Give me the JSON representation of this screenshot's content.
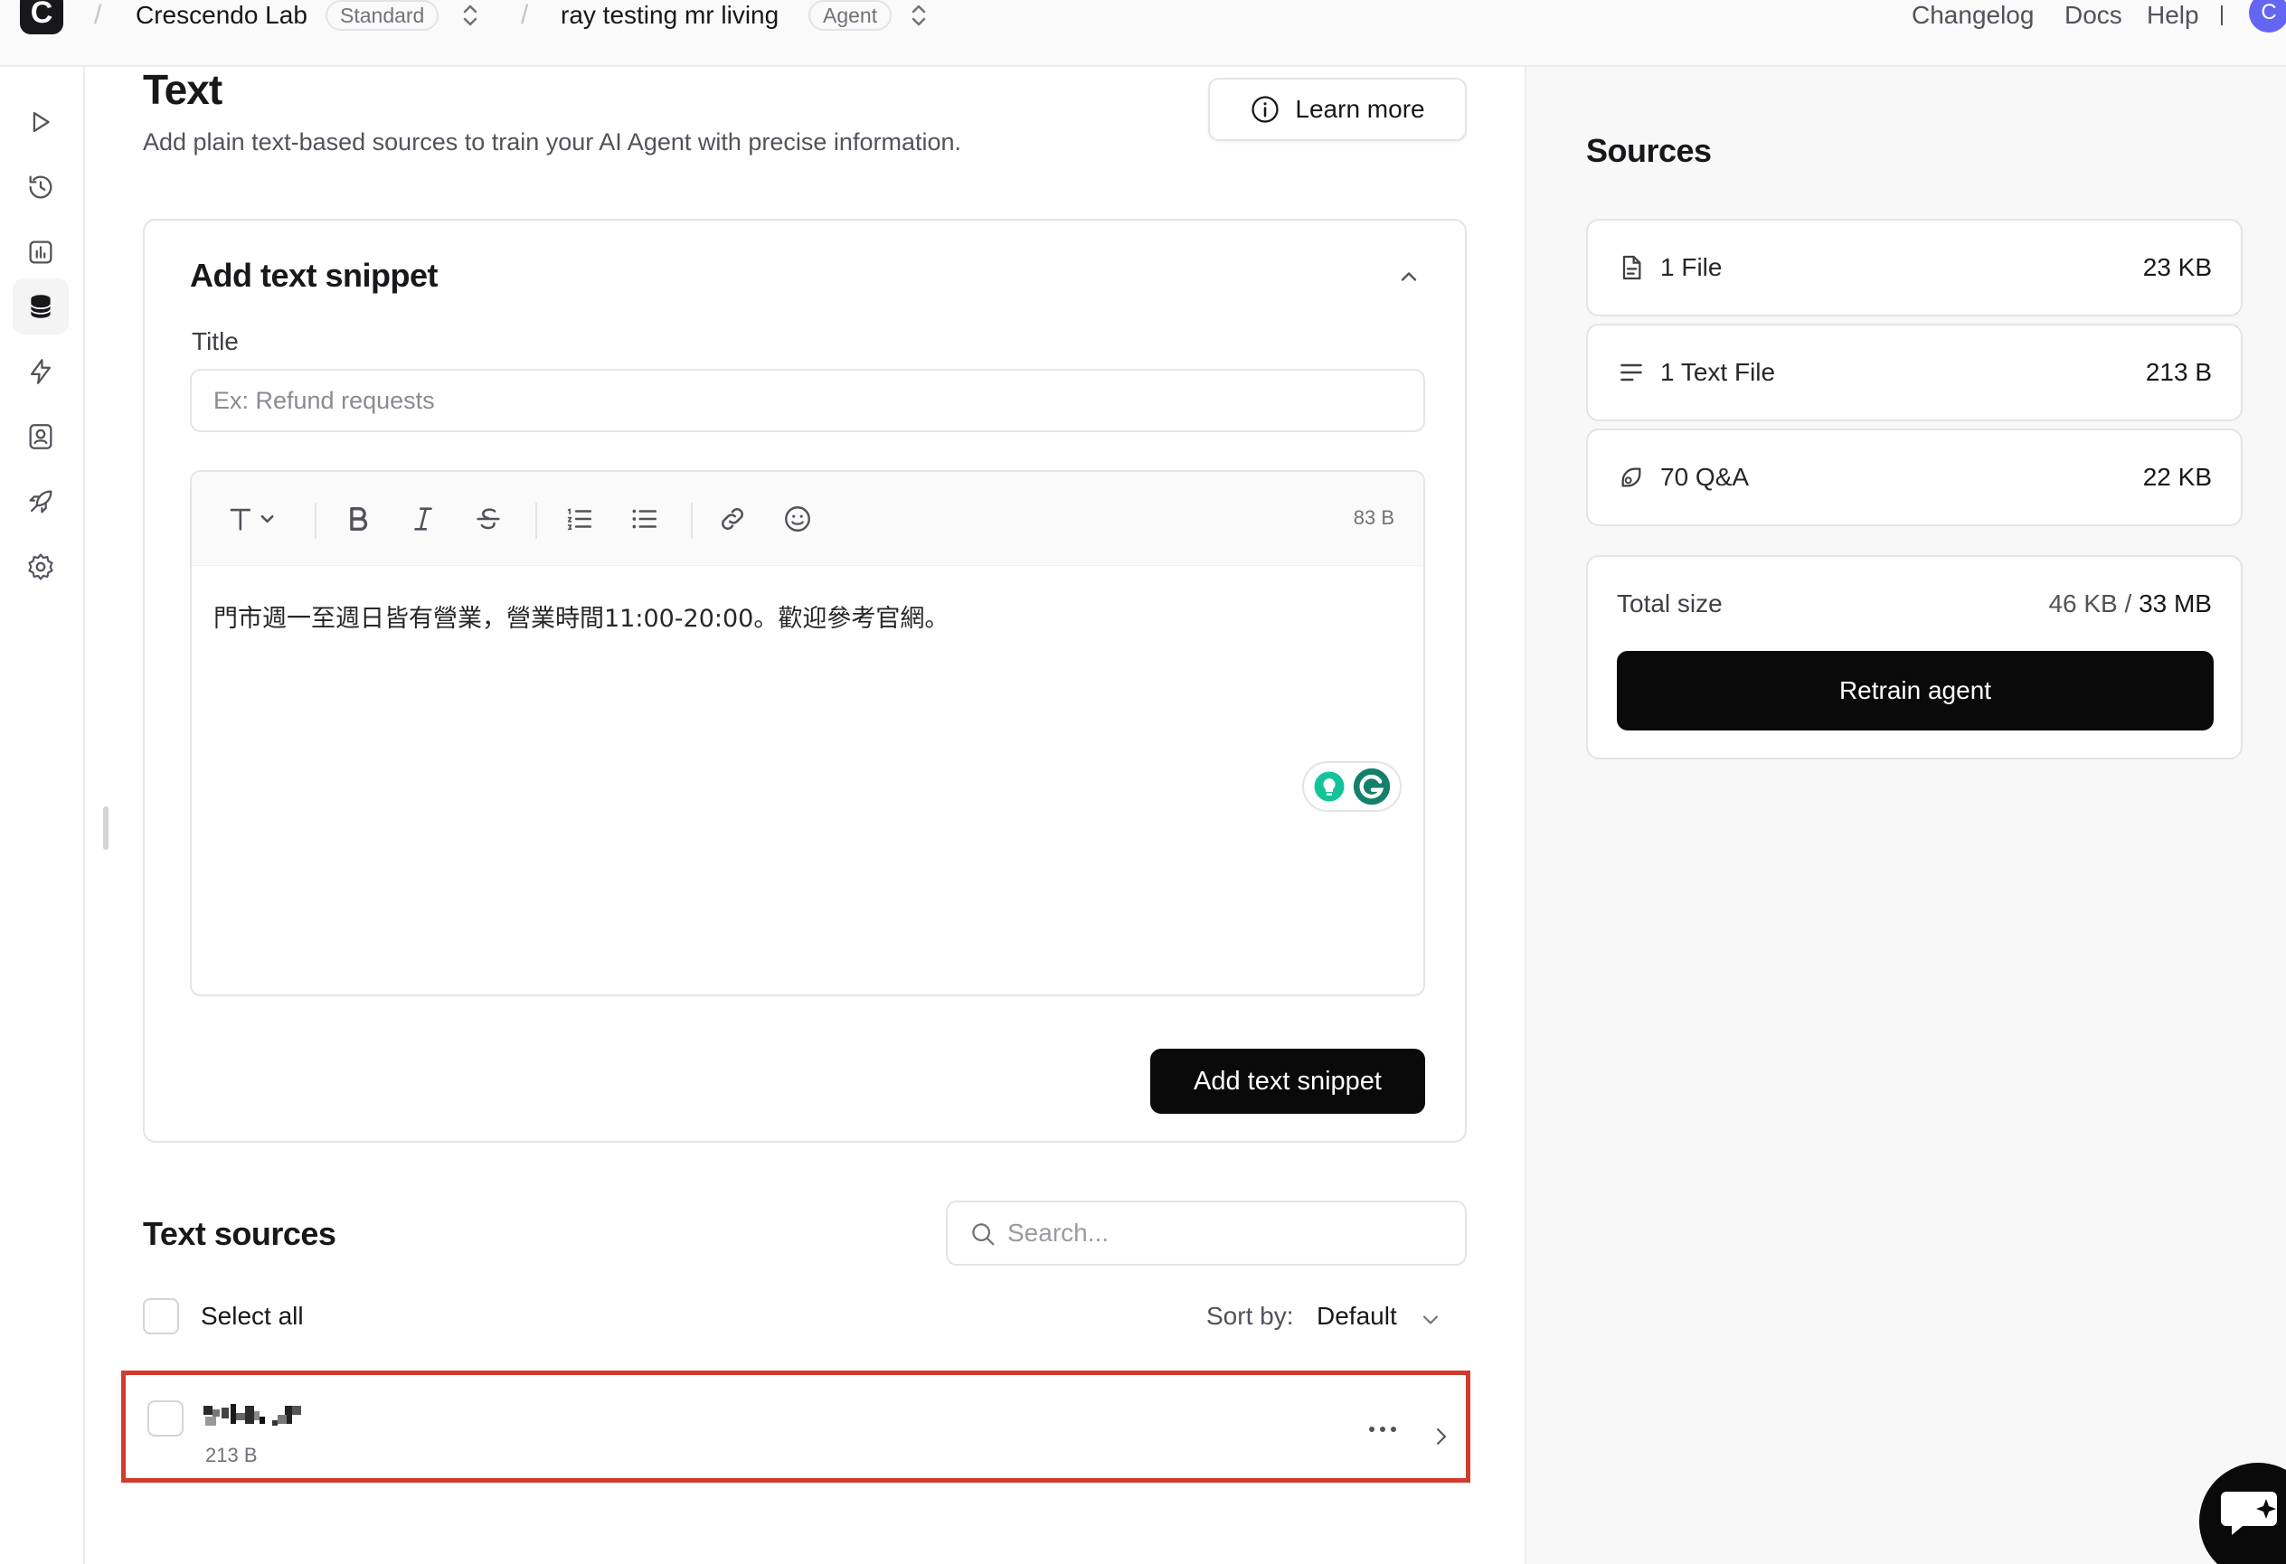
{
  "topbar": {
    "logo_letter": "C",
    "workspace": "Crescendo Lab",
    "workspace_badge": "Standard",
    "agent": "ray testing mr living",
    "agent_badge": "Agent",
    "links": [
      "Changelog",
      "Docs",
      "Help"
    ],
    "avatar_letter": "C"
  },
  "rail": {
    "items": [
      "play-icon",
      "history-icon",
      "analytics-icon",
      "database-icon",
      "actions-icon",
      "contacts-icon",
      "deploy-icon",
      "settings-icon"
    ],
    "active": "database-icon"
  },
  "main": {
    "title": "Text",
    "description": "Add plain text-based sources to train your AI Agent with precise information.",
    "learn_more": "Learn more"
  },
  "snippet": {
    "heading": "Add text snippet",
    "title_label": "Title",
    "title_placeholder": "Ex: Refund requests",
    "title_value": "",
    "byte_count": "83 B",
    "content": "門市週一至週日皆有營業，營業時間11:00-20:00。歡迎參考官網。",
    "submit_label": "Add text snippet"
  },
  "text_sources": {
    "heading": "Text sources",
    "search_placeholder": "Search...",
    "select_all": "Select all",
    "sort_label": "Sort by:",
    "sort_value": "Default",
    "rows": [
      {
        "size": "213 B"
      }
    ]
  },
  "sources_panel": {
    "heading": "Sources",
    "cards": [
      {
        "icon": "file-icon",
        "name": "1 File",
        "size": "23 KB"
      },
      {
        "icon": "text-lines-icon",
        "name": "1 Text File",
        "size": "213 B"
      },
      {
        "icon": "qa-icon",
        "name": "70 Q&A",
        "size": "22 KB"
      }
    ],
    "total_label": "Total size",
    "total_used": "46 KB",
    "total_separator": " / ",
    "total_limit": "33 MB",
    "retrain_label": "Retrain agent"
  },
  "colors": {
    "primary_button": "#0a0a0a",
    "highlight_border": "#d23b2c",
    "avatar": "#6366f1",
    "grammarly_green": "#15c39a"
  }
}
